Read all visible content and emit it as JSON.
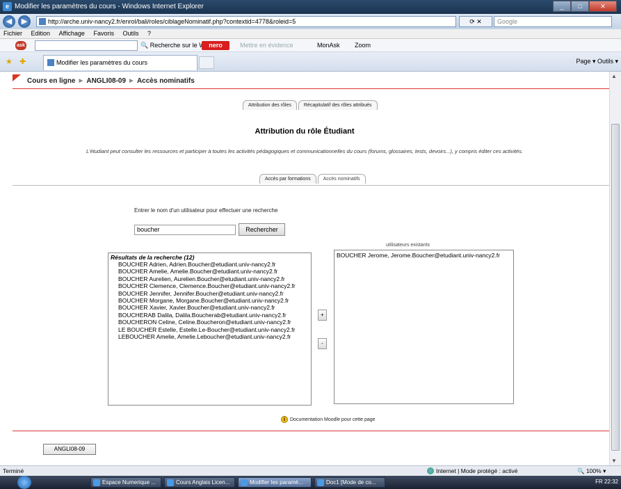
{
  "window": {
    "title": "Modifier les paramètres du cours - Windows Internet Explorer"
  },
  "address": {
    "url": "http://arche.univ-nancy2.fr/enrol/bali/roles/ciblageNominatif.php?contextid=4778&roleid=5",
    "search_placeholder": "Google"
  },
  "menu": [
    "Fichier",
    "Edition",
    "Affichage",
    "Favoris",
    "Outils",
    "?"
  ],
  "toolbar": {
    "web_search": "Recherche sur le Web",
    "nero": "nero",
    "highlight": "Mettre en évidence",
    "monask": "MonAsk",
    "zoom": "Zoom"
  },
  "tabbar": {
    "tab_title": "Modifier les paramètres du cours",
    "commands": "Page ▾   Outils ▾"
  },
  "breadcrumb": {
    "root": "Cours en ligne",
    "course": "ANGLI08-09",
    "current": "Accès nominatifs",
    "separator": "►"
  },
  "top_tabs": [
    "Attribution des rôles",
    "Récapitulatif des rôles attribués"
  ],
  "page": {
    "heading": "Attribution du rôle Étudiant",
    "description": "L'étudiant peut consulter les ressources et participer à toutes les activités pédagogiques et communicationnelles du cours (forums, glossaires, tests, devoirs...), y compris éditer ces activités."
  },
  "sub_tabs": [
    "Accès par formations",
    "Accès nominatifs"
  ],
  "search": {
    "label": "Entrer le nom d'un utilisateur pour effectuer une recherche",
    "value": "boucher",
    "button": "Rechercher"
  },
  "results": {
    "group_label": "Résultats de la recherche (12)",
    "items": [
      "BOUCHER Adrien, Adrien.Boucher@etudiant.univ-nancy2.fr",
      "BOUCHER Amelie, Amelie.Boucher@etudiant.univ-nancy2.fr",
      "BOUCHER Aurelien, Aurelien.Boucher@etudiant.univ-nancy2.fr",
      "BOUCHER Clemence, Clemence.Boucher@etudiant.univ-nancy2.fr",
      "BOUCHER Jennifer, Jennifer.Boucher@etudiant.univ-nancy2.fr",
      "BOUCHER Morgane, Morgane.Boucher@etudiant.univ-nancy2.fr",
      "BOUCHER Xavier, Xavier.Boucher@etudiant.univ-nancy2.fr",
      "BOUCHERAB Dalila, Dalila.Boucherab@etudiant.univ-nancy2.fr",
      "BOUCHERON Celine, Celine.Boucheron@etudiant.univ-nancy2.fr",
      "LE BOUCHER Estelle, Estelle.Le-Boucher@etudiant.univ-nancy2.fr",
      "LEBOUCHER Amelie, Amelie.Leboucher@etudiant.univ-nancy2.fr"
    ]
  },
  "existing": {
    "label": "utilisateurs existants",
    "items": [
      "BOUCHER Jerome, Jerome.Boucher@etudiant.univ-nancy2.fr"
    ]
  },
  "buttons": {
    "add": "+",
    "remove": "-"
  },
  "doc_link": "Documentation Moodle pour cette page",
  "course_button": "ANGLI08-09",
  "status": {
    "left": "Terminé",
    "zone": "Internet | Mode protégé : activé",
    "zoom": "100%"
  },
  "taskbar": {
    "tasks": [
      "Espace Numerique ...",
      "Cours Anglais Licen...",
      "Modifier les paramè...",
      "Doc1 [Mode de co..."
    ],
    "tray": "FR   22:32"
  },
  "colors": {
    "accent_red": "#d33333",
    "titlebar": "#1b3450"
  }
}
